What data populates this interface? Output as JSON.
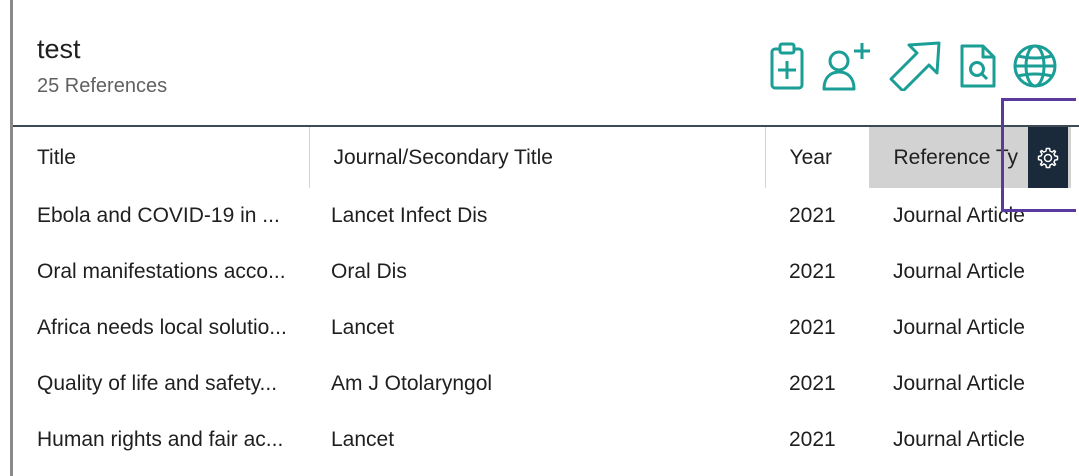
{
  "library": {
    "title": "test",
    "count_label": "25 References"
  },
  "toolbar": {
    "icons": [
      "clipboard-add-icon",
      "add-user-icon",
      "share-arrow-icon",
      "document-search-icon",
      "globe-icon"
    ],
    "accent_color": "#1a9e96"
  },
  "table": {
    "columns": [
      {
        "label": "Title"
      },
      {
        "label": "Journal/Secondary Title"
      },
      {
        "label": "Year"
      },
      {
        "label": "Reference Ty"
      }
    ],
    "rows": [
      {
        "title": "Ebola and COVID-19 in ...",
        "journal": "Lancet Infect Dis",
        "year": "2021",
        "type": "Journal Article"
      },
      {
        "title": "Oral manifestations acco...",
        "journal": "Oral Dis",
        "year": "2021",
        "type": "Journal Article"
      },
      {
        "title": "Africa needs local solutio...",
        "journal": "Lancet",
        "year": "2021",
        "type": "Journal Article"
      },
      {
        "title": "Quality of life and safety...",
        "journal": "Am J Otolaryngol",
        "year": "2021",
        "type": "Journal Article"
      },
      {
        "title": "Human rights and fair ac...",
        "journal": "Lancet",
        "year": "2021",
        "type": "Journal Article"
      }
    ],
    "sorted_column_bg": "#d2d2d2",
    "settings_bg": "#1b2a3a"
  },
  "highlight_color": "#5b3aa0"
}
